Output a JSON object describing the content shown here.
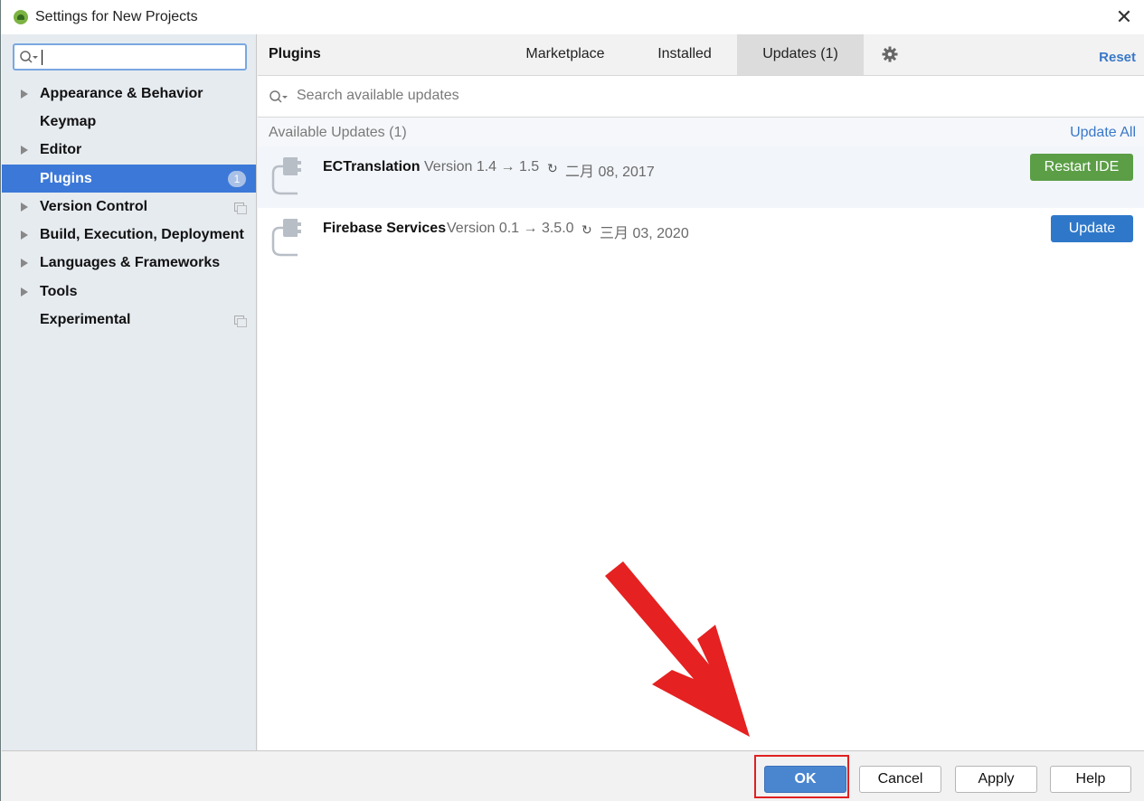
{
  "window": {
    "title": "Settings for New Projects"
  },
  "sidebar": {
    "search": {
      "value": ""
    },
    "items": [
      {
        "label": "Appearance & Behavior",
        "expandable": true
      },
      {
        "label": "Keymap",
        "expandable": false
      },
      {
        "label": "Editor",
        "expandable": true
      },
      {
        "label": "Plugins",
        "expandable": false,
        "selected": true,
        "badge": "1"
      },
      {
        "label": "Version Control",
        "expandable": true,
        "project_icon": true
      },
      {
        "label": "Build, Execution, Deployment",
        "expandable": true
      },
      {
        "label": "Languages & Frameworks",
        "expandable": true
      },
      {
        "label": "Tools",
        "expandable": true
      },
      {
        "label": "Experimental",
        "expandable": false,
        "project_icon": true
      }
    ]
  },
  "main": {
    "section_title": "Plugins",
    "tabs": [
      {
        "label": "Marketplace"
      },
      {
        "label": "Installed"
      },
      {
        "label": "Updates (1)",
        "active": true
      }
    ],
    "reset_label": "Reset",
    "search_placeholder": "Search available updates",
    "group": {
      "title": "Available Updates (1)",
      "update_all_label": "Update All"
    },
    "plugins": [
      {
        "name": "ECTranslation",
        "version": "Version 1.4 → 1.5",
        "date": "二月 08, 2017",
        "action": "Restart IDE"
      },
      {
        "name": "Firebase Services",
        "version": "Version 0.1 → 3.5.0",
        "date": "三月 03, 2020",
        "action": "Update"
      }
    ]
  },
  "footer": {
    "ok": "OK",
    "cancel": "Cancel",
    "apply": "Apply",
    "help": "Help"
  },
  "colors": {
    "selection": "#3b78d8",
    "restart_button": "#5b9e46",
    "update_button": "#2f78c9",
    "link": "#3a78c8",
    "annotation": "#e02020"
  }
}
